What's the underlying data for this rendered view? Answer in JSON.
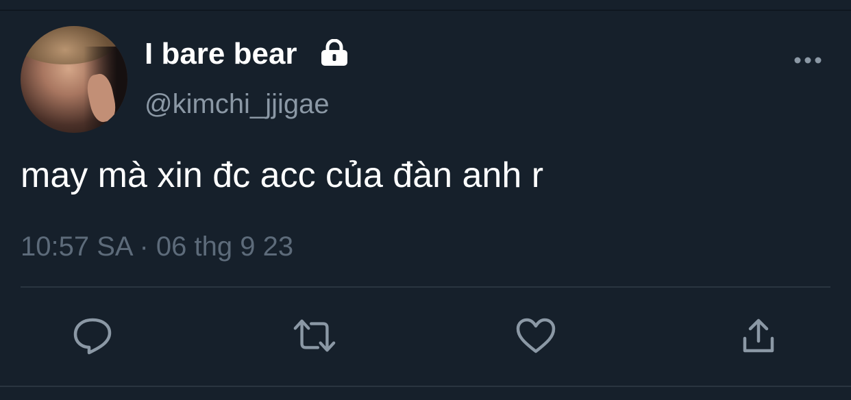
{
  "tweet": {
    "display_name": "I bare bear",
    "handle": "@kimchi_jjigae",
    "text": "may mà xin đc acc của đàn anh r",
    "timestamp": "10:57 SA · 06 thg 9 23",
    "protected": true
  },
  "icons": {
    "lock": "lock-icon",
    "more": "more-icon",
    "reply": "reply-icon",
    "retweet": "retweet-icon",
    "like": "heart-icon",
    "share": "share-icon"
  },
  "colors": {
    "background": "#16202b",
    "text_primary": "#ffffff",
    "text_secondary": "#8b98a5",
    "timestamp": "#5d6b7a",
    "icon": "#8b98a5",
    "divider": "#2a3540"
  }
}
